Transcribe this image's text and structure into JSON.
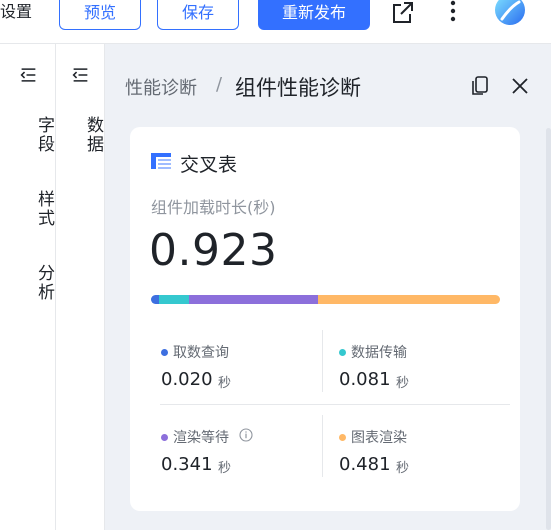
{
  "toolbar": {
    "settings_label": "设置",
    "preview_label": "预览",
    "save_label": "保存",
    "publish_label": "重新发布"
  },
  "left_rail": {
    "items": [
      {
        "label": "字段"
      },
      {
        "label": "样式"
      },
      {
        "label": "分析"
      }
    ]
  },
  "data_rail": {
    "label": "数据"
  },
  "panel": {
    "breadcrumb_parent": "性能诊断",
    "breadcrumb_separator": "/",
    "title": "组件性能诊断"
  },
  "card": {
    "title": "交叉表",
    "metric_label": "组件加载时长(秒)",
    "metric_value": "0.923",
    "stats": [
      {
        "name": "取数查询",
        "value": "0.020",
        "unit": "秒",
        "color": "#3d6fe0",
        "fraction": 0.02
      },
      {
        "name": "数据传输",
        "value": "0.081",
        "unit": "秒",
        "color": "#35c8cf",
        "fraction": 0.081
      },
      {
        "name": "渲染等待",
        "value": "0.341",
        "unit": "秒",
        "color": "#8c6fdb",
        "fraction": 0.341
      },
      {
        "name": "图表渲染",
        "value": "0.481",
        "unit": "秒",
        "color": "#ffb866",
        "fraction": 0.481
      }
    ]
  },
  "colors": {
    "accent": "#3370ff"
  }
}
